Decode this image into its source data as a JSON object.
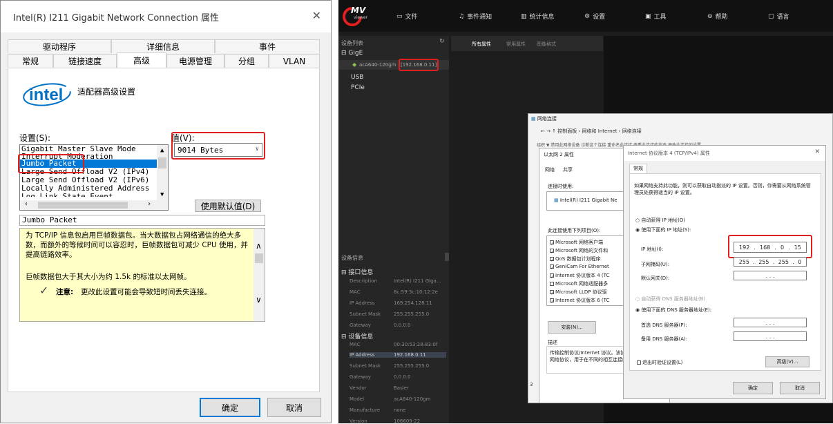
{
  "left_dialog": {
    "title": "Intel(R) I211 Gigabit Network Connection 属性",
    "tabs_row1": [
      "驱动程序",
      "详细信息",
      "事件"
    ],
    "tabs_row2": [
      "常规",
      "链接速度",
      "高级",
      "电源管理",
      "分组",
      "VLAN"
    ],
    "logo": "intel",
    "heading": "适配器高级设置",
    "settings_label": "设置(S):",
    "value_label": "值(V):",
    "list_items": [
      "Gigabit Master Slave Mode",
      "Interrupt Moderation",
      "Jumbo Packet",
      "Large Send Offload V2 (IPv4)",
      "Large Send Offload V2 (IPv6)",
      "Locally Administered Address",
      "Log Link State Event"
    ],
    "selected_item": "Jumbo Packet",
    "value": "9014 Bytes",
    "default_button": "使用默认值(D)",
    "desc_title": "Jumbo Packet",
    "desc_p1": "为 TCP/IP 信息包启用巨帧数据包。当大数据包占网络通信的绝大多数，而额外的等候时间可以容忍时，巨帧数据包可减少 CPU 使用，并提高链路效率。",
    "desc_p2": "巨帧数据包大于其大小为约 1.5k 的标准以太网帧。",
    "note_label": "注意:",
    "note_text": "更改此设置可能会导致短时间丢失连接。",
    "ok": "确定",
    "cancel": "取消"
  },
  "app": {
    "logo": "MV",
    "logo_sub": "viewer",
    "menu": [
      "文件",
      "事件通知",
      "统计信息",
      "设置",
      "工具",
      "帮助",
      "语言"
    ],
    "device_list_title": "设备列表",
    "tree": {
      "gige": "GigE",
      "device": "acA640-120gm",
      "device_ip": "[192.168.0.11]",
      "usb": "USB",
      "pcie": "PCIe"
    },
    "tabs": [
      "所有属性",
      "常用属性",
      "图像格式"
    ],
    "devinfo_title": "设备信息",
    "iface_title": "接口信息",
    "iface": [
      [
        "Description",
        "Intel(R) I211 Giga..."
      ],
      [
        "MAC",
        "8c:59:3c:10:12:2e"
      ],
      [
        "IP Address",
        "169.254.128.11"
      ],
      [
        "Subnet Mask",
        "255.255.255.0"
      ],
      [
        "Gateway",
        "0.0.0.0"
      ]
    ],
    "device_title": "设备信息",
    "device": [
      [
        "MAC",
        "00:30:53:28:83:0f"
      ],
      [
        "IP Address",
        "192.168.0.11"
      ],
      [
        "Subnet Mask",
        "255.255.255.0"
      ],
      [
        "Gateway",
        "0.0.0.0"
      ],
      [
        "Vendor",
        "Basler"
      ],
      [
        "Model",
        "acA640-120gm"
      ],
      [
        "Manufacture",
        "none"
      ],
      [
        "Version",
        "106609-22"
      ]
    ]
  },
  "netconn": {
    "title": "网络连接",
    "breadcrumb": "控制面板 › 网络和 Internet › 网络连接",
    "menu_hint": "组织 ▼   禁用此网络设备   诊断这个连接   重命名此连接   查看此连接的状态   更改此连接的设置"
  },
  "eth_props": {
    "title": "以太网 2 属性",
    "tabs": [
      "网络",
      "共享"
    ],
    "connect_using": "连接时使用:",
    "adapter": "Intel(R) I211 Gigabit Ne",
    "items_label": "此连接使用下列项目(O):",
    "items": [
      [
        "Microsoft 网络客户端",
        true
      ],
      [
        "Microsoft 网络的文件和",
        true
      ],
      [
        "QoS 数据包计划程序",
        true
      ],
      [
        "GenICam For Ethernet",
        true
      ],
      [
        "Internet 协议版本 4 (TC",
        true
      ],
      [
        "Microsoft 网络适配器多",
        false
      ],
      [
        "Microsoft LLDP 协议驱",
        true
      ],
      [
        "Internet 协议版本 6 (TC",
        true
      ]
    ],
    "install": "安装(N)...",
    "desc_label": "描述",
    "desc": "传输控制协议/Internet 协议。该协议是默认的广域网络协议，用于在不同的相互连接的网络上通信。"
  },
  "ipv4": {
    "title": "Internet 协议版本 4 (TCP/IPv4) 属性",
    "tab": "常规",
    "info": "如果网络支持此功能，则可以获取自动指派的 IP 设置。否则，你需要从网络系统管理员处获得适当的 IP 设置。",
    "auto_ip": "自动获得 IP 地址(O)",
    "use_ip": "使用下面的 IP 地址(S):",
    "ip_label": "IP 地址(I):",
    "ip": [
      "192",
      "168",
      "0",
      "15"
    ],
    "mask_label": "子网掩码(U):",
    "mask": [
      "255",
      "255",
      "255",
      "0"
    ],
    "gw_label": "默认网关(D):",
    "auto_dns": "自动获得 DNS 服务器地址(B)",
    "use_dns": "使用下面的 DNS 服务器地址(E):",
    "dns1": "首选 DNS 服务器(P):",
    "dns2": "备用 DNS 服务器(A):",
    "validate": "退出时验证设置(L)",
    "advanced": "高级(V)...",
    "ok": "确定",
    "cancel": "取消"
  }
}
